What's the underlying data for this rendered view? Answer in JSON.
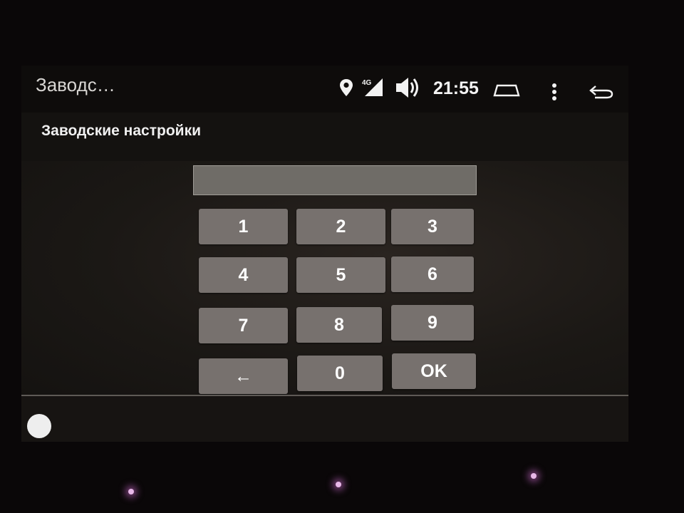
{
  "statusbar": {
    "app_title": "Заводс…",
    "network_label": "4G",
    "time": "21:55",
    "icons": [
      "location-icon",
      "signal-4g-icon",
      "volume-icon",
      "home-icon",
      "overflow-menu-icon",
      "back-icon"
    ]
  },
  "page": {
    "heading": "Заводские настройки"
  },
  "pin": {
    "value": ""
  },
  "keypad": {
    "keys": [
      "1",
      "2",
      "3",
      "4",
      "5",
      "6",
      "7",
      "8",
      "9",
      "←",
      "0",
      "OK"
    ]
  },
  "colors": {
    "key_background": "#77716e",
    "field_background": "#6f6c67",
    "screen_background": "#141210"
  }
}
